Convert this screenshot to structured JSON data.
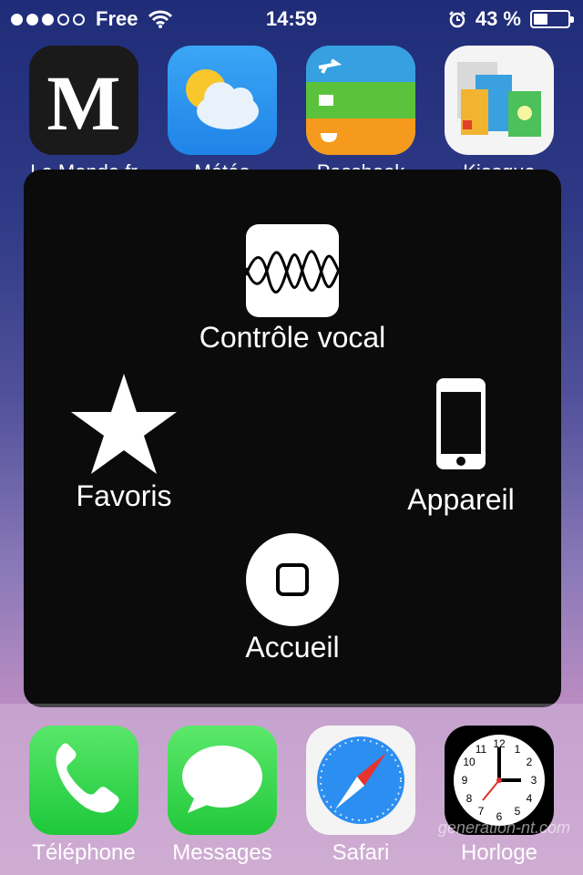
{
  "status_bar": {
    "carrier": "Free",
    "signal_dots_filled": 3,
    "signal_dots_total": 5,
    "time": "14:59",
    "battery_percent": "43 %",
    "battery_level": 0.43
  },
  "home_apps": [
    {
      "label": "Le Monde.fr",
      "icon": "le-monde-icon"
    },
    {
      "label": "Météo",
      "icon": "weather-icon"
    },
    {
      "label": "Passbook",
      "icon": "passbook-icon"
    },
    {
      "label": "Kiosque",
      "icon": "newsstand-icon"
    }
  ],
  "assistive_menu": {
    "voice_control": "Contrôle vocal",
    "favorites": "Favoris",
    "device": "Appareil",
    "home": "Accueil"
  },
  "dock": [
    {
      "label": "Téléphone",
      "icon": "phone-icon"
    },
    {
      "label": "Messages",
      "icon": "messages-icon"
    },
    {
      "label": "Safari",
      "icon": "safari-icon"
    },
    {
      "label": "Horloge",
      "icon": "clock-icon"
    }
  ],
  "watermark": "generation-nt.com",
  "colors": {
    "panel": "#0b0b0b",
    "phone_green": "#2fd24a",
    "weather_blue": "#2f9bf0"
  }
}
